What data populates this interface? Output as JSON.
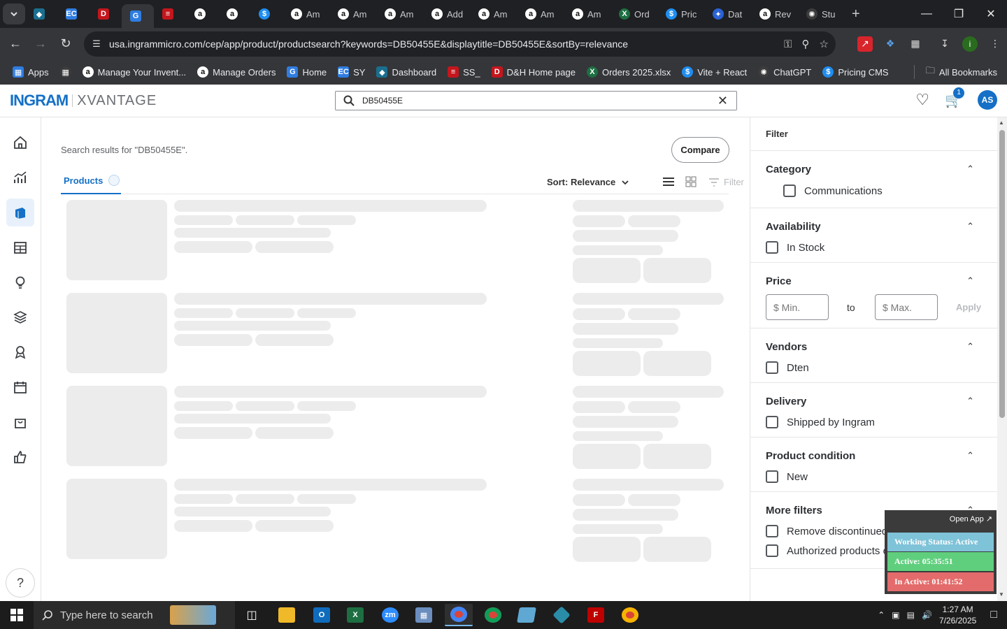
{
  "browser": {
    "tabs": [
      {
        "label": "",
        "icon": "diamond"
      },
      {
        "label": "",
        "icon": "ec"
      },
      {
        "label": "",
        "icon": "dh"
      },
      {
        "label": "",
        "icon": "ingram",
        "active": true
      },
      {
        "label": "",
        "icon": "ss"
      },
      {
        "label": "",
        "icon": "amazon"
      },
      {
        "label": "",
        "icon": "amazon"
      },
      {
        "label": "",
        "icon": "dollar"
      },
      {
        "label": "Am",
        "icon": "amazon"
      },
      {
        "label": "Am",
        "icon": "amazon"
      },
      {
        "label": "Am",
        "icon": "amazon"
      },
      {
        "label": "Add",
        "icon": "amazon"
      },
      {
        "label": "Am",
        "icon": "amazon"
      },
      {
        "label": "Am",
        "icon": "amazon"
      },
      {
        "label": "Am",
        "icon": "amazon"
      },
      {
        "label": "Ord",
        "icon": "excel"
      },
      {
        "label": "Pric",
        "icon": "dollar"
      },
      {
        "label": "Dat",
        "icon": "game"
      },
      {
        "label": "Rev",
        "icon": "amazon"
      },
      {
        "label": "Stu",
        "icon": "gpt"
      }
    ],
    "url": "usa.ingrammicro.com/cep/app/product/productsearch?keywords=DB50455E&displaytitle=DB50455E&sortBy=relevance",
    "profile_initial": "i",
    "bookmarks": [
      {
        "label": "Apps",
        "icon": "apps"
      },
      {
        "label": "",
        "icon": "grid"
      },
      {
        "label": "Manage Your Invent...",
        "icon": "amazon"
      },
      {
        "label": "Manage Orders",
        "icon": "amazon"
      },
      {
        "label": "Home",
        "icon": "ingram"
      },
      {
        "label": "SY",
        "icon": "ec"
      },
      {
        "label": "Dashboard",
        "icon": "diamond"
      },
      {
        "label": "SS_",
        "icon": "ss"
      },
      {
        "label": "D&H Home page",
        "icon": "dh"
      },
      {
        "label": "Orders 2025.xlsx",
        "icon": "excel"
      },
      {
        "label": "Vite + React",
        "icon": "dollar"
      },
      {
        "label": "ChatGPT",
        "icon": "gpt"
      },
      {
        "label": "Pricing CMS",
        "icon": "dollar"
      }
    ],
    "all_bookmarks": "All Bookmarks"
  },
  "header": {
    "logo_ingram": "INGRAM",
    "logo_xvantage": "XVANTAGE",
    "search_value": "DB50455E",
    "cart_count": "1",
    "user_initials": "AS"
  },
  "main": {
    "results_title": "Search results for \"DB50455E\".",
    "compare_label": "Compare",
    "tab_products": "Products",
    "sort_label": "Sort: Relevance",
    "filter_label": "Filter"
  },
  "filters": {
    "title": "Filter",
    "category": {
      "title": "Category",
      "options": [
        "Communications"
      ]
    },
    "availability": {
      "title": "Availability",
      "options": [
        "In Stock"
      ]
    },
    "price": {
      "title": "Price",
      "min_placeholder": "$ Min.",
      "to": "to",
      "max_placeholder": "$ Max.",
      "apply": "Apply"
    },
    "vendors": {
      "title": "Vendors",
      "options": [
        "Dten"
      ]
    },
    "delivery": {
      "title": "Delivery",
      "options": [
        "Shipped by Ingram"
      ]
    },
    "condition": {
      "title": "Product condition",
      "options": [
        "New"
      ]
    },
    "more": {
      "title": "More filters",
      "options": [
        "Remove discontinued products",
        "Authorized products only"
      ]
    }
  },
  "widget": {
    "open_app": "Open App ↗",
    "status": "Working Status: Active",
    "active": "Active: 05:35:51",
    "inactive": "In Active: 01:41:52"
  },
  "taskbar": {
    "search_placeholder": "Type here to search",
    "time": "1:27 AM",
    "date": "7/26/2025"
  }
}
